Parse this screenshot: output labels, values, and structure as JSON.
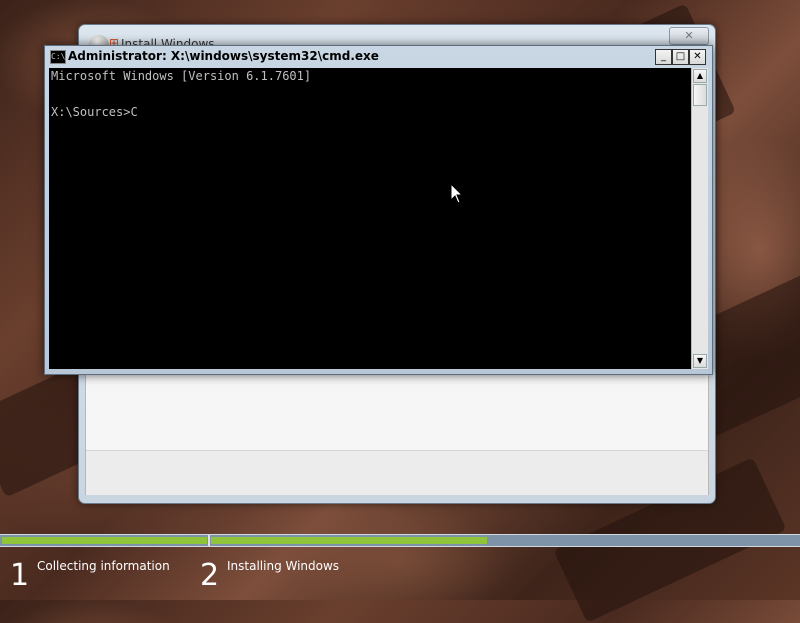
{
  "setup_window": {
    "title": "Install Windows",
    "close_glyph": "✕"
  },
  "cmd": {
    "title": "Administrator: X:\\windows\\system32\\cmd.exe",
    "icon_text": "C:\\",
    "minimize_glyph": "_",
    "maximize_glyph": "□",
    "close_glyph": "✕",
    "lines": [
      "Microsoft Windows [Version 6.1.7601]",
      "",
      "X:\\Sources>C"
    ],
    "scroll_up_glyph": "▲",
    "scroll_down_glyph": "▼"
  },
  "progress": {
    "steps": [
      {
        "number": "1",
        "label": "Collecting information"
      },
      {
        "number": "2",
        "label": "Installing Windows"
      }
    ],
    "step1_fraction": 1.0,
    "step2_fraction": 0.47,
    "fill_color": "#8fc43b",
    "track_color": "#7f93a8"
  },
  "icons": {
    "cursor": "arrow-cursor-icon",
    "cmd": "cmd-icon",
    "setup_orb": "back-orb-icon"
  }
}
